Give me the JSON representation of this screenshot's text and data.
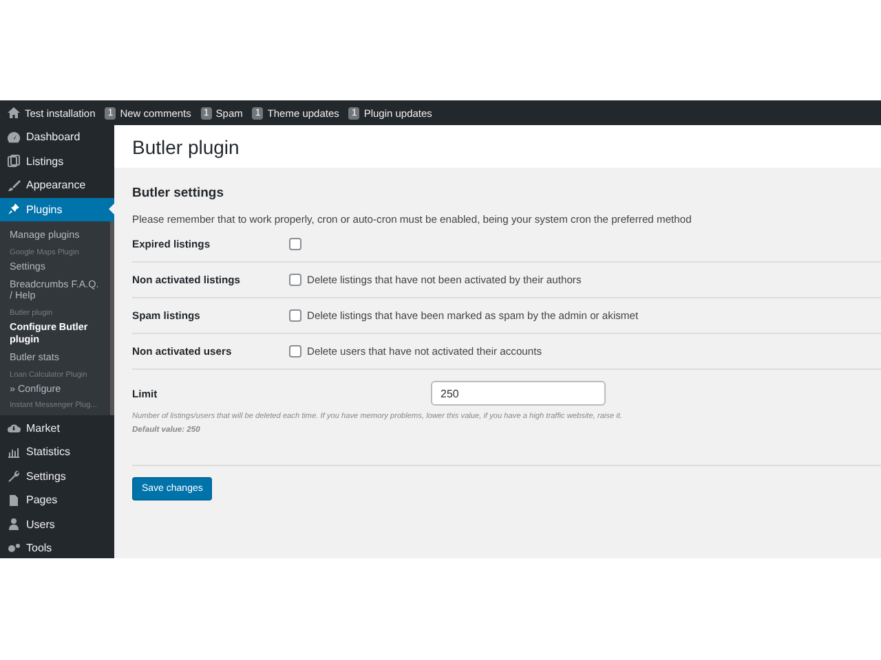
{
  "admin_bar": {
    "site": "Test installation",
    "items": [
      {
        "count": "1",
        "label": "New comments"
      },
      {
        "count": "1",
        "label": "Spam"
      },
      {
        "count": "1",
        "label": "Theme updates"
      },
      {
        "count": "1",
        "label": "Plugin updates"
      }
    ]
  },
  "sidebar": {
    "items": [
      {
        "label": "Dashboard",
        "selected": false
      },
      {
        "label": "Listings",
        "selected": false
      },
      {
        "label": "Appearance",
        "selected": false
      },
      {
        "label": "Plugins",
        "selected": true,
        "children": [
          {
            "kind": "link",
            "label": "Manage plugins",
            "selected": false
          },
          {
            "kind": "heading",
            "label": "Google Maps Plugin"
          },
          {
            "kind": "link",
            "label": "Settings",
            "selected": false
          },
          {
            "kind": "link",
            "label": "Breadcrumbs F.A.Q. / Help",
            "selected": false
          },
          {
            "kind": "heading",
            "label": "Butler plugin"
          },
          {
            "kind": "link",
            "label": "Configure Butler plugin",
            "selected": true
          },
          {
            "kind": "link",
            "label": "Butler stats",
            "selected": false
          },
          {
            "kind": "heading",
            "label": "Loan Calculator Plugin"
          },
          {
            "kind": "link",
            "label": "» Configure",
            "selected": false
          },
          {
            "kind": "heading",
            "label": "Instant Messenger Plug..."
          }
        ]
      },
      {
        "label": "Market",
        "selected": false
      },
      {
        "label": "Statistics",
        "selected": false
      },
      {
        "label": "Settings",
        "selected": false
      },
      {
        "label": "Pages",
        "selected": false
      },
      {
        "label": "Users",
        "selected": false
      },
      {
        "label": "Tools",
        "selected": false
      }
    ]
  },
  "page": {
    "title": "Butler plugin",
    "section": "Butler settings",
    "notice": "Please remember that to work properly, cron or auto-cron must be enabled, being your system cron the preferred method",
    "settings": [
      {
        "kind": "checkbox",
        "label": "Expired listings",
        "checked": false
      },
      {
        "kind": "checkbox",
        "label": "Non activated listings",
        "checked": false,
        "text": "Delete listings that have not been activated by their authors"
      },
      {
        "kind": "checkbox",
        "label": "Spam listings",
        "checked": false,
        "text": "Delete listings that have been marked as spam by the admin or akismet"
      },
      {
        "kind": "checkbox",
        "label": "Non activated users",
        "checked": false,
        "text": "Delete users that have not activated their accounts"
      },
      {
        "kind": "number",
        "label": "Limit",
        "value": "250",
        "help": "Number of listings/users that will be deleted each time. If you have memory problems, lower this value, if you have a high traffic website, raise it.",
        "default": "Default value: 250"
      }
    ],
    "save_button": "Save changes"
  }
}
